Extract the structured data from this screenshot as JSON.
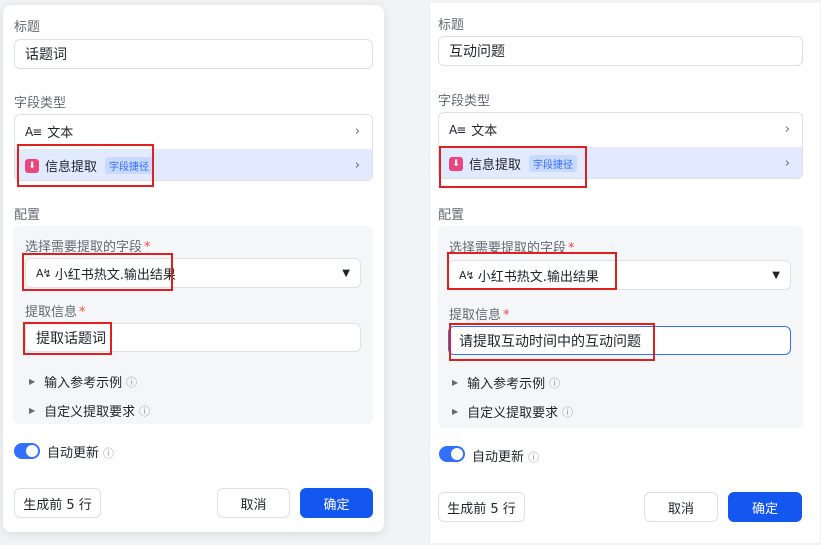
{
  "left": {
    "title_label": "标题",
    "title_value": "话题词",
    "field_type_label": "字段类型",
    "type_option_text": "文本",
    "type_option_text_icon": "A≡",
    "type_option_extract": "信息提取",
    "type_option_extract_badge": "字段捷径",
    "config_label": "配置",
    "select_field_label": "选择需要提取的字段",
    "select_field_value": "小红书热文.输出结果",
    "field_icon": "A↯",
    "extract_info_label": "提取信息",
    "extract_info_value": "提取话题词",
    "example_label": "输入参考示例",
    "custom_label": "自定义提取要求",
    "auto_update_label": "自动更新",
    "preview_button": "生成前 5 行",
    "cancel_button": "取消",
    "confirm_button": "确定"
  },
  "right": {
    "title_label": "标题",
    "title_value": "互动问题",
    "field_type_label": "字段类型",
    "type_option_text": "文本",
    "type_option_text_icon": "A≡",
    "type_option_extract": "信息提取",
    "type_option_extract_badge": "字段捷径",
    "config_label": "配置",
    "select_field_label": "选择需要提取的字段",
    "select_field_value": "小红书热文.输出结果",
    "field_icon": "A↯",
    "extract_info_label": "提取信息",
    "extract_info_value": "请提取互动时间中的互动问题",
    "example_label": "输入参考示例",
    "custom_label": "自定义提取要求",
    "auto_update_label": "自动更新",
    "preview_button": "生成前 5 行",
    "cancel_button": "取消",
    "confirm_button": "确定"
  },
  "required_mark": "*",
  "info_icon": "ⓘ",
  "chevron_icon": "›",
  "caret_icon": "▼",
  "triangle_icon": "▶",
  "colors": {
    "accent": "#1456f0",
    "highlight": "#e02020",
    "selected_row": "#e1eaff",
    "extract_icon": "#e8467c"
  }
}
